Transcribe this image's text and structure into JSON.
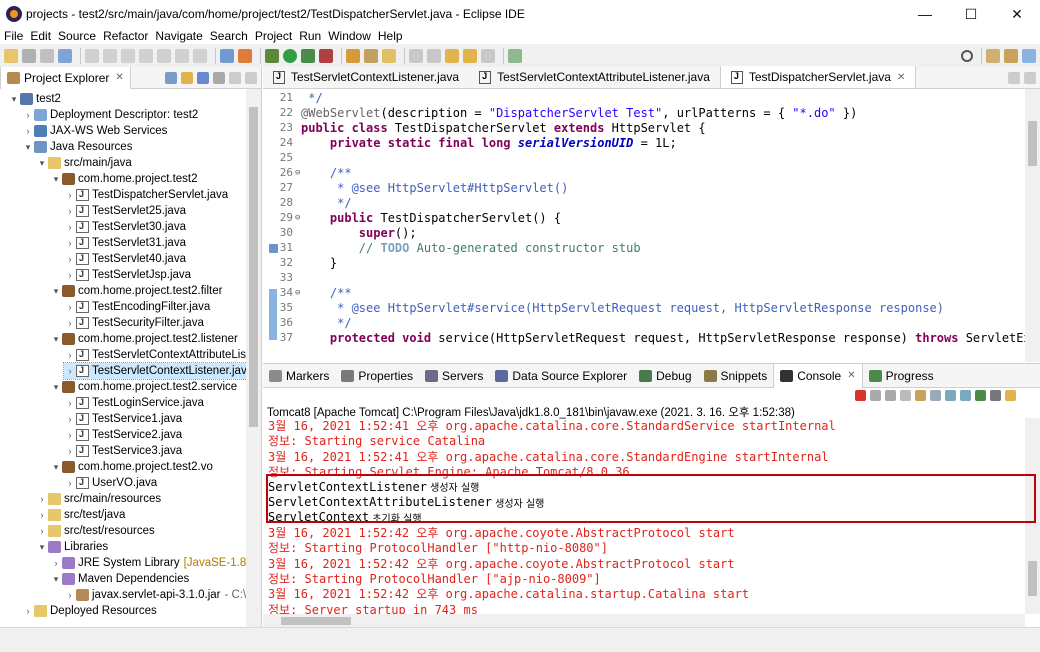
{
  "window": {
    "title": "projects - test2/src/main/java/com/home/project/test2/TestDispatcherServlet.java - Eclipse IDE",
    "minimize": "—",
    "maximize": "☐",
    "close": "✕"
  },
  "menu": [
    "File",
    "Edit",
    "Source",
    "Refactor",
    "Navigate",
    "Search",
    "Project",
    "Run",
    "Window",
    "Help"
  ],
  "project_explorer": {
    "tab_label": "Project Explorer",
    "close": "✕",
    "tree": [
      {
        "label": "test2",
        "arrow": "▾",
        "icon": "proj"
      },
      {
        "label": "Deployment Descriptor: test2",
        "arrow": "›",
        "icon": "dd"
      },
      {
        "label": "JAX-WS Web Services",
        "arrow": "›",
        "icon": "ws"
      },
      {
        "label": "Java Resources",
        "arrow": "▾",
        "icon": "jr"
      },
      {
        "label": "src/main/java",
        "arrow": "▾",
        "icon": "folder"
      },
      {
        "label": "com.home.project.test2",
        "arrow": "▾",
        "icon": "pkg"
      },
      {
        "label": "TestDispatcherServlet.java",
        "arrow": "›",
        "icon": "jfile"
      },
      {
        "label": "TestServlet25.java",
        "arrow": "›",
        "icon": "jfile"
      },
      {
        "label": "TestServlet30.java",
        "arrow": "›",
        "icon": "jfile"
      },
      {
        "label": "TestServlet31.java",
        "arrow": "›",
        "icon": "jfile"
      },
      {
        "label": "TestServlet40.java",
        "arrow": "›",
        "icon": "jfile"
      },
      {
        "label": "TestServletJsp.java",
        "arrow": "›",
        "icon": "jfile"
      },
      {
        "label": "com.home.project.test2.filter",
        "arrow": "▾",
        "icon": "pkg"
      },
      {
        "label": "TestEncodingFilter.java",
        "arrow": "›",
        "icon": "jfile"
      },
      {
        "label": "TestSecurityFilter.java",
        "arrow": "›",
        "icon": "jfile"
      },
      {
        "label": "com.home.project.test2.listener",
        "arrow": "▾",
        "icon": "pkg"
      },
      {
        "label": "TestServletContextAttributeListe",
        "arrow": "›",
        "icon": "jfile"
      },
      {
        "label": "TestServletContextListener.java",
        "arrow": "›",
        "icon": "jfile",
        "selected": true
      },
      {
        "label": "com.home.project.test2.service",
        "arrow": "▾",
        "icon": "pkg"
      },
      {
        "label": "TestLoginService.java",
        "arrow": "›",
        "icon": "jfile"
      },
      {
        "label": "TestService1.java",
        "arrow": "›",
        "icon": "jfile"
      },
      {
        "label": "TestService2.java",
        "arrow": "›",
        "icon": "jfile"
      },
      {
        "label": "TestService3.java",
        "arrow": "›",
        "icon": "jfile"
      },
      {
        "label": "com.home.project.test2.vo",
        "arrow": "▾",
        "icon": "pkg"
      },
      {
        "label": "UserVO.java",
        "arrow": "›",
        "icon": "jfile"
      },
      {
        "label": "src/main/resources",
        "arrow": "›",
        "icon": "folder"
      },
      {
        "label": "src/test/java",
        "arrow": "›",
        "icon": "folder"
      },
      {
        "label": "src/test/resources",
        "arrow": "›",
        "icon": "folder"
      },
      {
        "label": "Libraries",
        "arrow": "▾",
        "icon": "lib"
      },
      {
        "label": "JRE System Library",
        "extra": "[JavaSE-1.8]",
        "arrow": "›",
        "icon": "lib"
      },
      {
        "label": "Maven Dependencies",
        "arrow": "▾",
        "icon": "lib"
      },
      {
        "label": "javax.servlet-api-3.1.0.jar",
        "extra2": "- C:\\U:",
        "arrow": "›",
        "icon": "jar"
      },
      {
        "label": "Deployed Resources",
        "arrow": "›",
        "icon": "folder"
      }
    ]
  },
  "editor": {
    "tabs": [
      {
        "label": "TestServletContextListener.java"
      },
      {
        "label": "TestServletContextAttributeListener.java"
      },
      {
        "label": "TestDispatcherServlet.java",
        "active": true,
        "close": "✕"
      }
    ],
    "lines": [
      {
        "n": "21",
        "parts": [
          [
            "jd",
            " */"
          ]
        ]
      },
      {
        "n": "22",
        "parts": [
          [
            "ann",
            "@WebServlet"
          ],
          [
            "",
            "(description = "
          ],
          [
            "str",
            "\"DispatcherServlet Test\""
          ],
          [
            "",
            ", urlPatterns = { "
          ],
          [
            "str",
            "\"*.do\""
          ],
          [
            "",
            " })"
          ]
        ]
      },
      {
        "n": "23",
        "parts": [
          [
            "kw",
            "public class"
          ],
          [
            "",
            " TestDispatcherServlet "
          ],
          [
            "kw",
            "extends"
          ],
          [
            "",
            " HttpServlet {"
          ]
        ]
      },
      {
        "n": "24",
        "parts": [
          [
            "",
            "    "
          ],
          [
            "kw",
            "private static final long"
          ],
          [
            "",
            " "
          ],
          [
            "fld",
            "serialVersionUID"
          ],
          [
            "",
            " = 1L;"
          ]
        ]
      },
      {
        "n": "25",
        "parts": []
      },
      {
        "n": "26",
        "fold": "⊖",
        "parts": [
          [
            "jd",
            "    /**"
          ]
        ]
      },
      {
        "n": "27",
        "parts": [
          [
            "jd",
            "     * @see HttpServlet#HttpServlet()"
          ]
        ]
      },
      {
        "n": "28",
        "parts": [
          [
            "jd",
            "     */"
          ]
        ]
      },
      {
        "n": "29",
        "fold": "⊖",
        "parts": [
          [
            "",
            "    "
          ],
          [
            "kw",
            "public"
          ],
          [
            "",
            " TestDispatcherServlet() {"
          ]
        ]
      },
      {
        "n": "30",
        "parts": [
          [
            "",
            "        "
          ],
          [
            "kw",
            "super"
          ],
          [
            "",
            "();"
          ]
        ]
      },
      {
        "n": "31",
        "parts": [
          [
            "cmt",
            "        // "
          ],
          [
            "todo",
            "TODO"
          ],
          [
            "cmt",
            " Auto-generated constructor stub"
          ]
        ]
      },
      {
        "n": "32",
        "parts": [
          [
            "",
            "    }"
          ]
        ]
      },
      {
        "n": "33",
        "parts": []
      },
      {
        "n": "34",
        "fold": "⊖",
        "parts": [
          [
            "jd",
            "    /**"
          ]
        ]
      },
      {
        "n": "35",
        "parts": [
          [
            "jd",
            "     * @see HttpServlet#service(HttpServletRequest request, HttpServletResponse response)"
          ]
        ]
      },
      {
        "n": "36",
        "parts": [
          [
            "jd",
            "     */"
          ]
        ]
      },
      {
        "n": "37",
        "parts": [
          [
            "",
            "    "
          ],
          [
            "kw",
            "protected void"
          ],
          [
            "",
            " service(HttpServletRequest request, HttpServletResponse response) "
          ],
          [
            "kw",
            "throws"
          ],
          [
            "",
            " ServletExcepti"
          ]
        ]
      }
    ]
  },
  "bottom_panel": {
    "tabs": [
      {
        "label": "Markers",
        "icon": "#8b8b8b"
      },
      {
        "label": "Properties",
        "icon": "#7a7a7a"
      },
      {
        "label": "Servers",
        "icon": "#6a6a8a"
      },
      {
        "label": "Data Source Explorer",
        "icon": "#5a6aa0"
      },
      {
        "label": "Debug",
        "icon": "#4a7a4a"
      },
      {
        "label": "Snippets",
        "icon": "#8a7a4a"
      },
      {
        "label": "Console",
        "icon": "#333333",
        "active": true,
        "close": "✕"
      },
      {
        "label": "Progress",
        "icon": "#4a8a4a"
      }
    ],
    "console_header": "Tomcat8 [Apache Tomcat] C:\\Program Files\\Java\\jdk1.8.0_181\\bin\\javaw.exe  (2021. 3. 16. 오후 1:52:38)",
    "lines": [
      {
        "type": "err",
        "text": "3월 16, 2021 1:52:41 오후 org.apache.catalina.core.StandardService startInternal"
      },
      {
        "type": "err",
        "text": "정보: Starting service Catalina"
      },
      {
        "type": "err",
        "text": "3월 16, 2021 1:52:41 오후 org.apache.catalina.core.StandardEngine startInternal"
      },
      {
        "type": "err",
        "text": "정보: Starting Servlet Engine: Apache Tomcat/8.0.36"
      },
      {
        "type": "out",
        "text": "ServletContextListener",
        "kor": " 생성자 실행"
      },
      {
        "type": "out",
        "text": "ServletContextAttributeListener",
        "kor": " 생성자 실행"
      },
      {
        "type": "out",
        "text": "ServletContext",
        "kor": " 초기화 실행"
      },
      {
        "type": "err",
        "text": "3월 16, 2021 1:52:42 오후 org.apache.coyote.AbstractProtocol start"
      },
      {
        "type": "err",
        "text": "정보: Starting ProtocolHandler [\"http-nio-8080\"]"
      },
      {
        "type": "err",
        "text": "3월 16, 2021 1:52:42 오후 org.apache.coyote.AbstractProtocol start"
      },
      {
        "type": "err",
        "text": "정보: Starting ProtocolHandler [\"ajp-nio-8009\"]"
      },
      {
        "type": "err",
        "text": "3월 16, 2021 1:52:42 오후 org.apache.catalina.startup.Catalina start"
      },
      {
        "type": "err",
        "text": "정보: Server startup in 743 ms"
      }
    ]
  },
  "colors": {
    "error_red": "#e0241b",
    "highlight": "#c0000c",
    "keyword": "#7f0055",
    "string": "#2a00ff"
  }
}
